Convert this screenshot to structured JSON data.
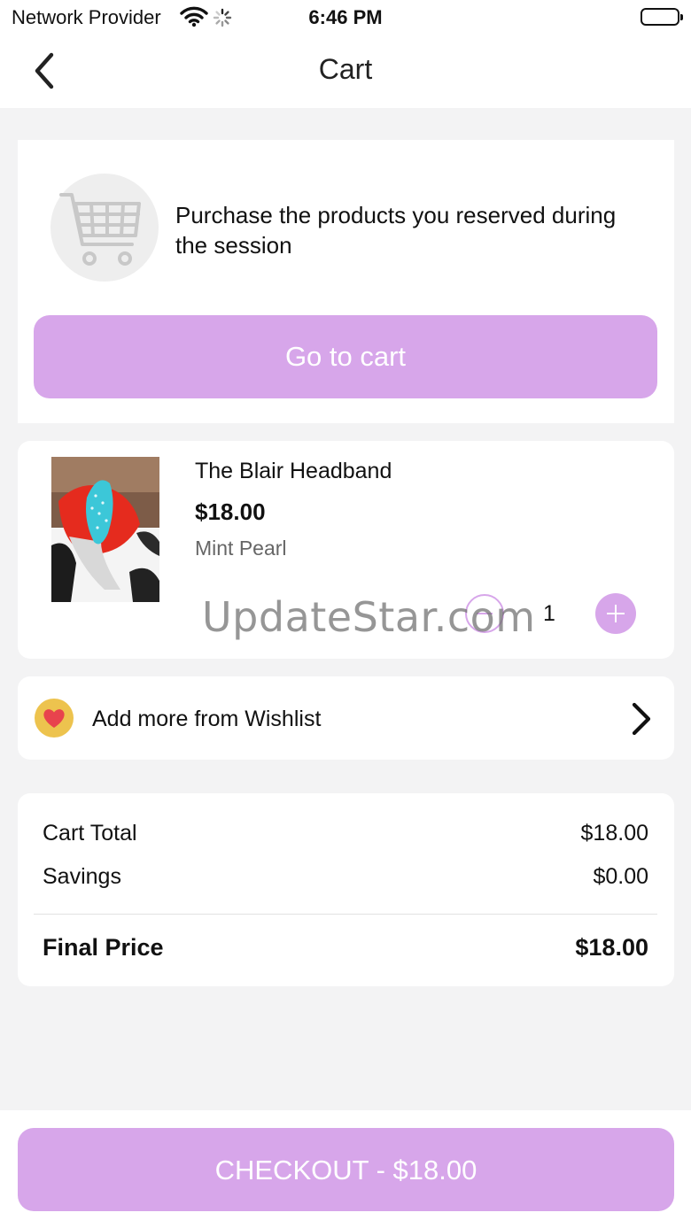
{
  "status_bar": {
    "carrier": "Network Provider",
    "time": "6:46 PM"
  },
  "nav": {
    "title": "Cart"
  },
  "promo": {
    "text": "Purchase the products you reserved during the session",
    "button_label": "Go to cart"
  },
  "cart_item": {
    "name": "The Blair Headband",
    "price": "$18.00",
    "variant": "Mint Pearl",
    "quantity": "1"
  },
  "watermark": "UpdateStar.com",
  "wishlist": {
    "label": "Add more from Wishlist"
  },
  "totals": {
    "cart_total_label": "Cart Total",
    "cart_total_value": "$18.00",
    "savings_label": "Savings",
    "savings_value": "$0.00",
    "final_label": "Final Price",
    "final_value": "$18.00"
  },
  "checkout": {
    "label": "CHECKOUT - $18.00"
  },
  "colors": {
    "accent": "#d7a6ea",
    "background": "#f3f3f4",
    "wishlist_icon_bg": "#edc34e"
  }
}
